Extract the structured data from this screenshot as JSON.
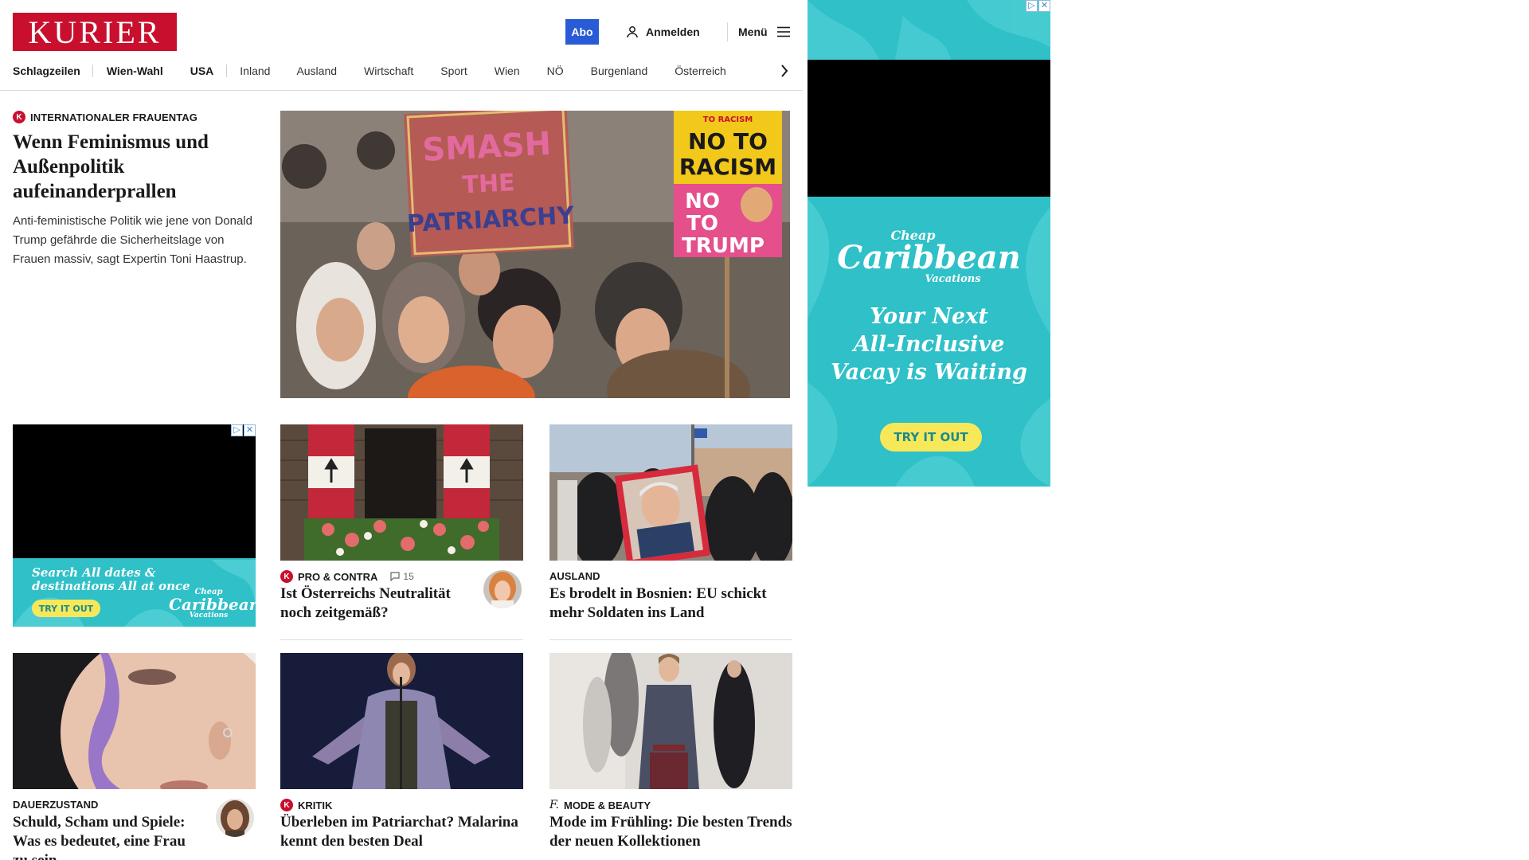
{
  "header": {
    "logo_text": "KURIER",
    "abo_label": "Abo",
    "login_label": "Anmelden",
    "menu_label": "Menü",
    "brand_color": "#c8102e",
    "abo_color": "#2a5bd7"
  },
  "nav": {
    "items": [
      "Schlagzeilen",
      "Wien-Wahl",
      "USA",
      "Inland",
      "Ausland",
      "Wirtschaft",
      "Sport",
      "Wien",
      "NÖ",
      "Burgenland",
      "Österreich"
    ],
    "more_icon": "chevron-right-icon"
  },
  "hero": {
    "kicker": "INTERNATIONALER FRAUENTAG",
    "badge": "K",
    "title": "Wenn Feminismus und Außenpolitik aufeinanderprallen",
    "teaser": "Anti-feministische Politik wie jene von Donald Trump gefährde die Sicherheitslage von Frauen massiv, sagt Expertin Toni Haastrup.",
    "image": {
      "sign1_line1": "SMASH",
      "sign1_line2": "THE",
      "sign1_line3": "PATRIARCHY",
      "sign2_line1": "NO TO",
      "sign2_line2": "RACISM",
      "sign2_line3": "NO",
      "sign2_line4": "TO",
      "sign2_line5": "TRUMP",
      "sign2_top": "TO RACISM"
    }
  },
  "cards": [
    {
      "kicker": "PRO & CONTRA",
      "badge": "K",
      "comments": "15",
      "title": "Ist Österreichs Neutralität noch zeitgemäß?"
    },
    {
      "kicker": "AUSLAND",
      "title": "Es brodelt in Bosnien: EU schickt mehr Soldaten ins Land"
    },
    {
      "kicker": "DAUERZUSTAND",
      "title": "Schuld, Scham und Spiele: Was es bedeutet, eine Frau zu sein"
    },
    {
      "kicker": "KRITIK",
      "badge": "K",
      "title": "Überleben im Patriarchat? Malarina kennt den besten Deal"
    },
    {
      "kicker": "MODE & BEAUTY",
      "badge": "f.",
      "title": "Mode im Frühling: Die besten Trends der neuen Kollektionen"
    }
  ],
  "ads": {
    "small": {
      "headline_line1": "Search All dates &",
      "headline_line2": "destinations All at once",
      "cta": "TRY IT OUT",
      "brand_line1": "Cheap",
      "brand_line2": "Caribbean",
      "brand_line3": "Vacations"
    },
    "side": {
      "brand_line1": "Cheap",
      "brand_line2": "Caribbean",
      "brand_line3": "Vacations",
      "headline_line1": "Your Next",
      "headline_line2": "All-Inclusive",
      "headline_line3": "Vacay is Waiting",
      "cta": "TRY IT OUT"
    },
    "adchoices_icon": "▷",
    "close_icon": "✕",
    "accent": "#2fc0c8"
  }
}
